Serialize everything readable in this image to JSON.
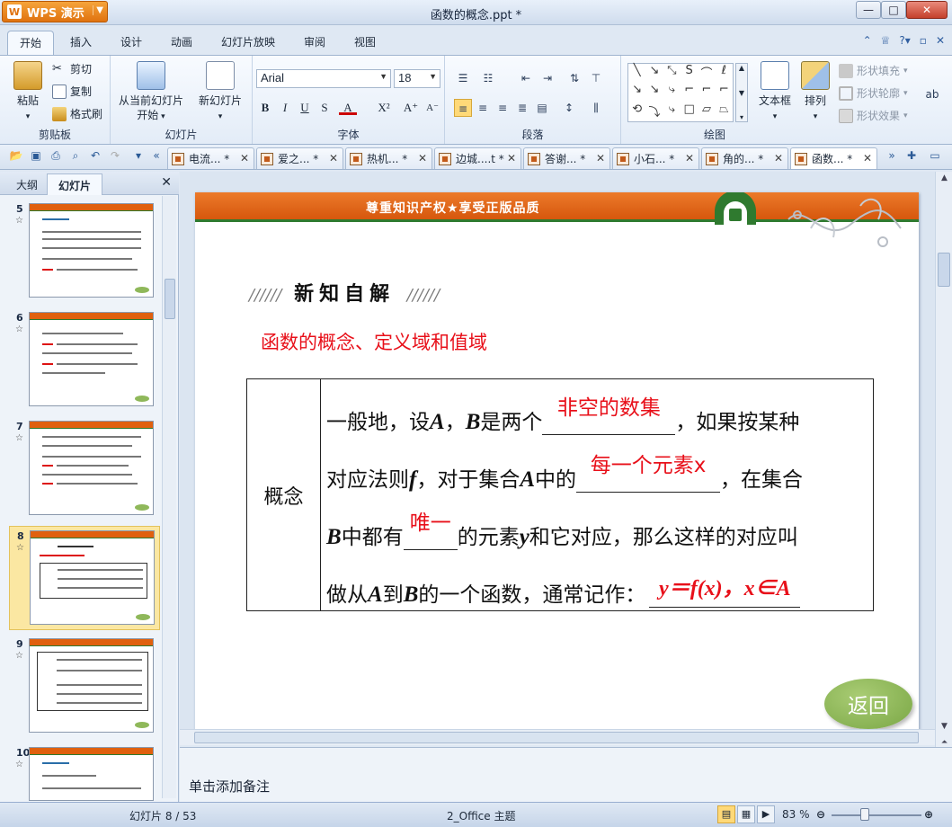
{
  "window": {
    "app_button": "WPS 演示",
    "title": "函数的概念.ppt *"
  },
  "ribbon_tabs": [
    "开始",
    "插入",
    "设计",
    "动画",
    "幻灯片放映",
    "审阅",
    "视图"
  ],
  "ribbon": {
    "clipboard": {
      "paste": "粘贴",
      "cut": "剪切",
      "copy": "复制",
      "format_painter": "格式刷",
      "label": "剪贴板"
    },
    "slides": {
      "from_current": "从当前幻灯片",
      "from_current_2": "开始",
      "new_slide": "新幻灯片",
      "label": "幻灯片"
    },
    "font": {
      "name": "Arial",
      "size": "18",
      "label": "字体"
    },
    "paragraph": {
      "label": "段落"
    },
    "drawing": {
      "textbox": "文本框",
      "arrange": "排列",
      "fill": "形状填充",
      "outline": "形状轮廓",
      "effect": "形状效果",
      "label": "绘图"
    }
  },
  "doc_tabs": [
    {
      "label": "电流...  *"
    },
    {
      "label": "爱之...  *"
    },
    {
      "label": "热机...  *"
    },
    {
      "label": "边城....t *"
    },
    {
      "label": "答谢...  *"
    },
    {
      "label": "小石...  *"
    },
    {
      "label": "角的...  *"
    },
    {
      "label": "函数...  *"
    }
  ],
  "left_pane": {
    "tab_outline": "大纲",
    "tab_slides": "幻灯片",
    "thumbnails": [
      {
        "number": "5"
      },
      {
        "number": "6"
      },
      {
        "number": "7"
      },
      {
        "number": "8"
      },
      {
        "number": "9"
      },
      {
        "number": "10"
      }
    ]
  },
  "slide": {
    "banner": "尊重知识产权★享受正版品质",
    "heading_stripes": "//////",
    "heading": "新知自解",
    "subheading": "函数的概念、定义域和值域",
    "concept_label": "概念",
    "line1_a": "一般地，设",
    "var_A": "A",
    "comma": "，",
    "var_B": "B",
    "line1_b": "是两个",
    "answer1": "非空的数集",
    "line1_c": "，如果按某种",
    "line2_a": "对应法则",
    "var_f": "f",
    "line2_b": "，对于集合",
    "line2_c": "中的",
    "answer2": "每一个元素x",
    "line2_d": "，在集合",
    "line3_a": "中都有",
    "answer3": "唯一",
    "line3_b": "的元素",
    "var_y": "y",
    "line3_c": "和它对应，那么这样的对应叫",
    "line4_a": "做从",
    "line4_b": "到",
    "line4_c": "的一个函数，通常记作：",
    "answer4": "y＝f(x)，x∈A",
    "return_button": "返回"
  },
  "notes_placeholder": "单击添加备注",
  "status": {
    "slide_count": "幻灯片 8 / 53",
    "theme": "2_Office 主题",
    "zoom": "83 %"
  }
}
